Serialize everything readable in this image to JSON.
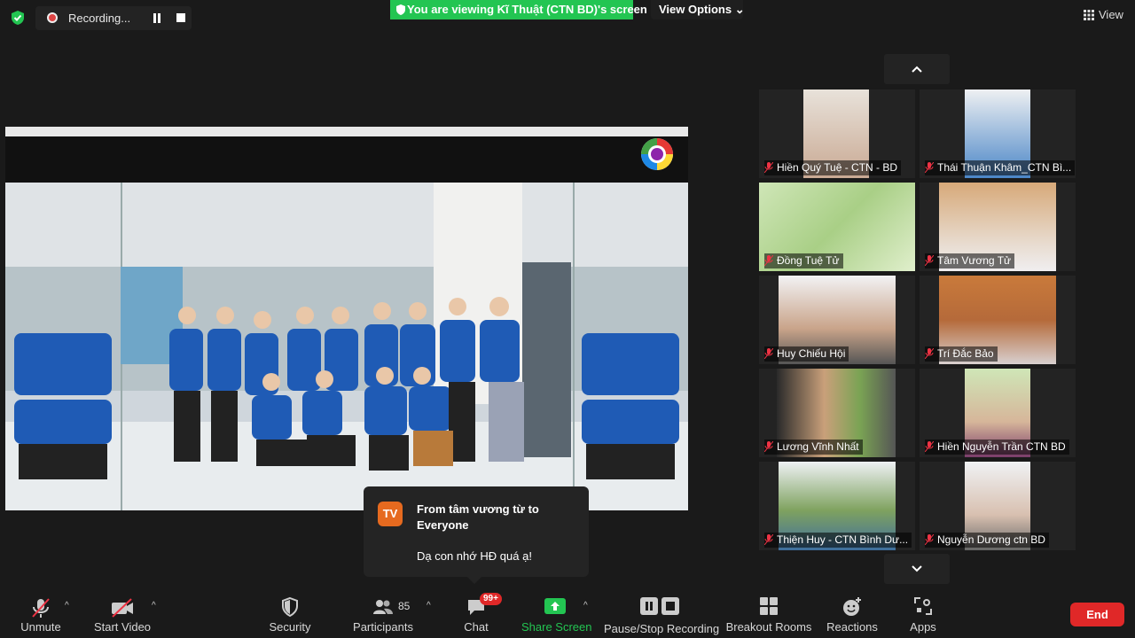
{
  "top": {
    "recording_label": "Recording...",
    "viewing_text": "You are viewing Kĩ Thuật (CTN BD)'s screen",
    "view_options_label": "View Options ⌄",
    "view_label": "View"
  },
  "participants": [
    {
      "name": "Hiền Quý Tuệ - CTN - BD"
    },
    {
      "name": "Thái Thuận Khâm_CTN Bì..."
    },
    {
      "name": "Đồng Tuệ Tử"
    },
    {
      "name": "Tâm Vương Tử"
    },
    {
      "name": "Huy Chiếu Hội"
    },
    {
      "name": "Trí Đắc Bảo"
    },
    {
      "name": "Lương Vĩnh Nhất"
    },
    {
      "name": "Hiền Nguyễn Trần CTN BD"
    },
    {
      "name": "Thiện Huy - CTN Bình Dư..."
    },
    {
      "name": "Nguyễn Dương ctn BD"
    }
  ],
  "chat_popup": {
    "avatar": "TV",
    "from": "From tâm vương từ to Everyone",
    "message": "Dạ con nhớ HĐ quá ạ!"
  },
  "toolbar": {
    "unmute": "Unmute",
    "start_video": "Start Video",
    "security": "Security",
    "participants": "Participants",
    "participants_count": "85",
    "chat": "Chat",
    "chat_badge": "99+",
    "share_screen": "Share Screen",
    "pause_recording": "Pause/Stop Recording",
    "breakout_rooms": "Breakout Rooms",
    "reactions": "Reactions",
    "apps": "Apps",
    "end": "End"
  },
  "colors": {
    "accent_green": "#23c552",
    "end_red": "#e02828",
    "chat_avatar": "#e66a1f",
    "background": "#1a1a1a"
  },
  "icons": [
    "shield-icon",
    "record-icon",
    "pause-icon",
    "stop-icon",
    "view-grid-icon",
    "mic-muted-icon",
    "video-off-icon",
    "security-icon",
    "participants-icon",
    "chat-icon",
    "share-screen-icon",
    "pause-recording-icon",
    "breakout-rooms-icon",
    "reactions-icon",
    "apps-icon",
    "chevron-up-icon",
    "chevron-down-icon"
  ]
}
